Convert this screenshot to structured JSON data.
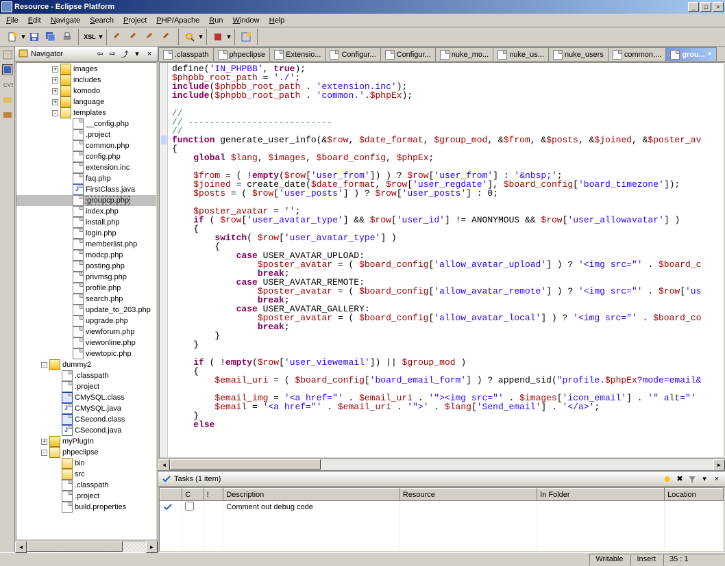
{
  "window": {
    "title": "Resource - Eclipse Platform"
  },
  "menus": [
    "File",
    "Edit",
    "Navigate",
    "Search",
    "Project",
    "PHP/Apache",
    "Run",
    "Window",
    "Help"
  ],
  "navigator": {
    "title": "Navigator",
    "tree": [
      {
        "l": 3,
        "t": "folder",
        "exp": "+",
        "label": "images"
      },
      {
        "l": 3,
        "t": "folder",
        "exp": "+",
        "label": "includes"
      },
      {
        "l": 3,
        "t": "folder",
        "exp": "+",
        "label": "komodo"
      },
      {
        "l": 3,
        "t": "folder",
        "exp": "+",
        "label": "language"
      },
      {
        "l": 3,
        "t": "folder-open",
        "exp": "-",
        "label": "templates"
      },
      {
        "l": 4,
        "t": "file",
        "label": "__config.php"
      },
      {
        "l": 4,
        "t": "file",
        "label": ".project"
      },
      {
        "l": 4,
        "t": "file",
        "label": "common.php"
      },
      {
        "l": 4,
        "t": "file",
        "label": "config.php"
      },
      {
        "l": 4,
        "t": "file",
        "label": "extension.inc"
      },
      {
        "l": 4,
        "t": "file",
        "label": "faq.php"
      },
      {
        "l": 4,
        "t": "java",
        "label": "FirstClass.java"
      },
      {
        "l": 4,
        "t": "file",
        "label": "groupcp.php",
        "selected": true
      },
      {
        "l": 4,
        "t": "file",
        "label": "index.php"
      },
      {
        "l": 4,
        "t": "file",
        "label": "install.php"
      },
      {
        "l": 4,
        "t": "file",
        "label": "login.php"
      },
      {
        "l": 4,
        "t": "file",
        "label": "memberlist.php"
      },
      {
        "l": 4,
        "t": "file",
        "label": "modcp.php"
      },
      {
        "l": 4,
        "t": "file",
        "label": "posting.php"
      },
      {
        "l": 4,
        "t": "file",
        "label": "privmsg.php"
      },
      {
        "l": 4,
        "t": "file",
        "label": "profile.php"
      },
      {
        "l": 4,
        "t": "file",
        "label": "search.php"
      },
      {
        "l": 4,
        "t": "file",
        "label": "update_to_203.php"
      },
      {
        "l": 4,
        "t": "file",
        "label": "upgrade.php"
      },
      {
        "l": 4,
        "t": "file",
        "label": "viewforum.php"
      },
      {
        "l": 4,
        "t": "file",
        "label": "viewonline.php"
      },
      {
        "l": 4,
        "t": "file",
        "label": "viewtopic.php"
      },
      {
        "l": 2,
        "t": "folder",
        "exp": "-",
        "label": "dummy2"
      },
      {
        "l": 3,
        "t": "file",
        "label": ".classpath"
      },
      {
        "l": 3,
        "t": "file",
        "label": ".project"
      },
      {
        "l": 3,
        "t": "class",
        "label": "CMySQL.class"
      },
      {
        "l": 3,
        "t": "java",
        "label": "CMySQL.java"
      },
      {
        "l": 3,
        "t": "class",
        "label": "CSecond.class"
      },
      {
        "l": 3,
        "t": "java",
        "label": "CSecond.java"
      },
      {
        "l": 2,
        "t": "folder",
        "exp": "+",
        "label": "myPlugIn"
      },
      {
        "l": 2,
        "t": "folder-open",
        "exp": "-",
        "label": "phpeclipse"
      },
      {
        "l": 3,
        "t": "folder-open",
        "label": "bin"
      },
      {
        "l": 3,
        "t": "folder-open",
        "label": "src"
      },
      {
        "l": 3,
        "t": "file",
        "label": ".classpath"
      },
      {
        "l": 3,
        "t": "file",
        "label": ".project"
      },
      {
        "l": 3,
        "t": "file",
        "label": "build.properties"
      }
    ]
  },
  "editorTabs": [
    {
      "label": ".classpath"
    },
    {
      "label": "phpeclipse"
    },
    {
      "label": "Extensio..."
    },
    {
      "label": "Configur..."
    },
    {
      "label": "Configur..."
    },
    {
      "label": "nuke_mo..."
    },
    {
      "label": "nuke_us..."
    },
    {
      "label": "nuke_users"
    },
    {
      "label": "common...."
    },
    {
      "label": "grou...",
      "active": true
    }
  ],
  "tasks": {
    "title": "Tasks (1 item)",
    "columns": [
      "",
      "C",
      "!",
      "Description",
      "Resource",
      "In Folder",
      "Location"
    ],
    "rows": [
      {
        "check": true,
        "desc": "Comment out debug code",
        "resource": "",
        "folder": "",
        "location": ""
      }
    ]
  },
  "statusbar": {
    "writable": "Writable",
    "insert": "Insert",
    "pos": "35 : 1"
  }
}
